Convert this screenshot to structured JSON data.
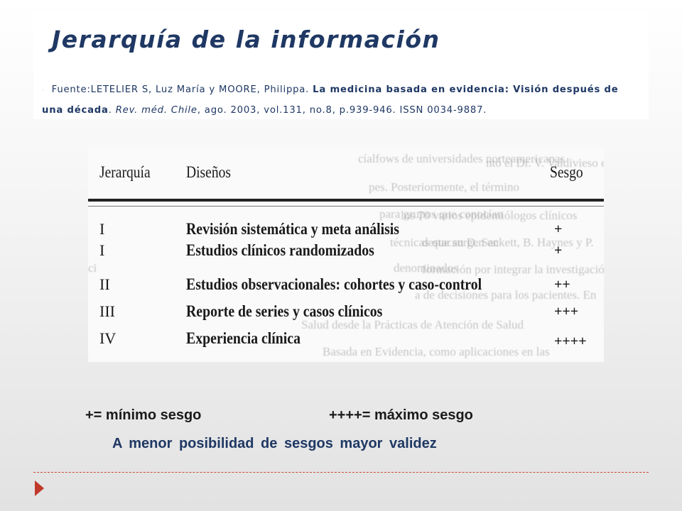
{
  "slide": {
    "title": "Jerarquía de la información",
    "citation": {
      "lead": "·",
      "authors": "Fuente:LETELIER  S, Luz María y MOORE, Philippa. ",
      "article_title": "La medicina basada en evidencia: Visión después de una década",
      "sep": ". ",
      "journal": "Rev. méd. Chile",
      "details": ", ago. 2003, vol.131, no.8, p.939-946. ISSN 0034-9887."
    },
    "table": {
      "headers": {
        "level": "Jerarquía",
        "design": "Diseños",
        "bias": "Sesgo"
      },
      "rows": [
        {
          "level": "I",
          "design": "Revisión sistemática y meta análisis",
          "bias": "+"
        },
        {
          "level": "I",
          "design": "Estudios clínicos randomizados",
          "bias": "+"
        },
        {
          "level": "II",
          "design": "Estudios observacionales: cohortes y caso-control",
          "bias": "++"
        },
        {
          "level": "III",
          "design": "Reporte de series y casos clínicos",
          "bias": "+++"
        },
        {
          "level": "IV",
          "design": "Experiencia clínica",
          "bias": "++++"
        }
      ]
    },
    "legend": {
      "min": "+= mínimo sesgo",
      "max": "++++= máximo sesgo"
    },
    "conclusion": "A menor  posibilidad  de  sesgos  mayor  validez",
    "colors": {
      "title": "#1f3864",
      "accent": "#c0392b"
    },
    "icons": {
      "bullet": "arrow-right-icon"
    }
  }
}
